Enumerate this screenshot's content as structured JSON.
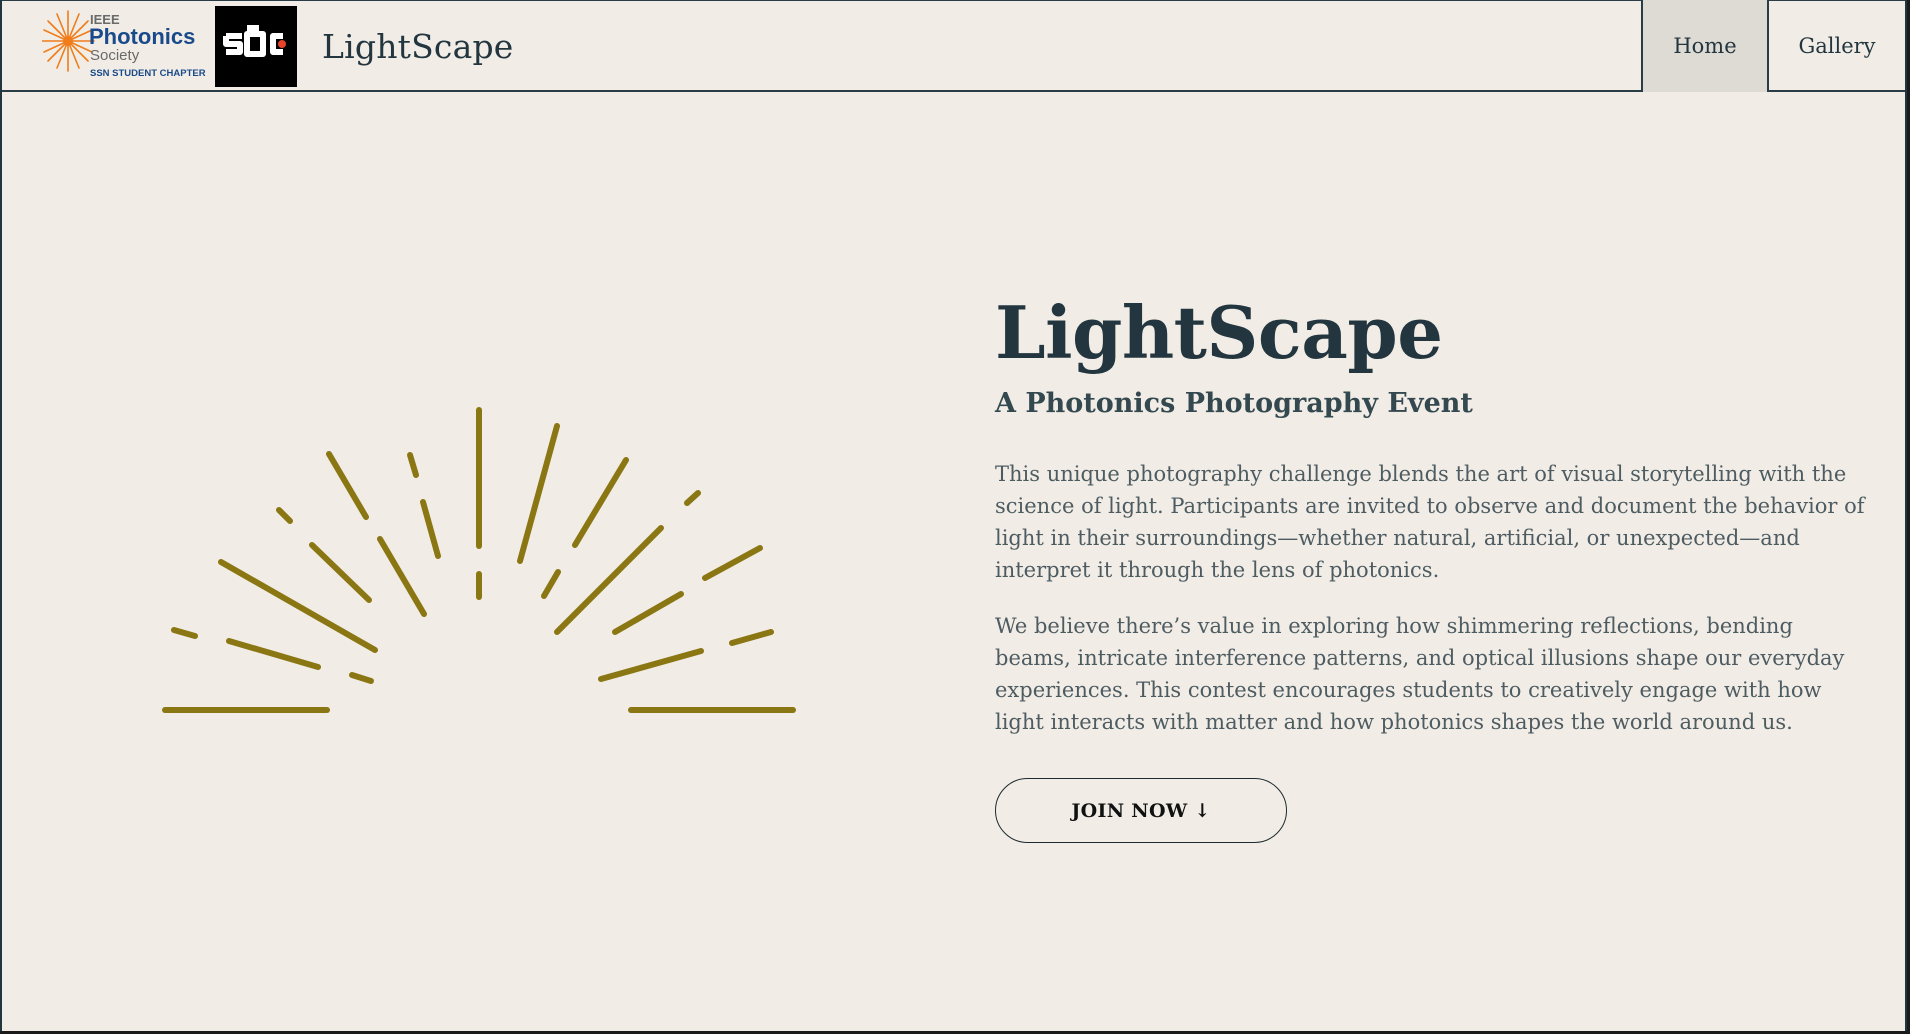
{
  "header": {
    "logos": {
      "ieee": {
        "line1": "IEEE",
        "line2": "Photonics",
        "line3": "Society",
        "line4": "SSN STUDENT CHAPTER",
        "icon": "sunburst-logo-icon",
        "accent_color": "#f07d1a",
        "text_color": "#1a4a8a"
      },
      "sdc": {
        "text": "SDC",
        "icon": "sdc-logo-icon",
        "background": "#000000",
        "dot_color": "#e8432b"
      }
    },
    "brand_title": "LightScape",
    "nav": {
      "home_label": "Home",
      "gallery_label": "Gallery",
      "active": "Home"
    }
  },
  "hero": {
    "illustration": "light-rays-icon",
    "ray_color": "#8a7612",
    "title": "LightScape",
    "subtitle": "A Photonics Photography Event",
    "paragraph1": "This unique photography challenge blends the art of visual storytelling with the science of light. Participants are invited to observe and document the behavior of light in their surroundings—whether natural, artificial, or unexpected—and interpret it through the lens of photonics.",
    "paragraph2": "We believe there’s value in exploring how shimmering reflections, bending beams, intricate interference patterns, and optical illusions shape our everyday experiences. This contest encourages students to creatively engage with how light interacts with matter and how photonics shapes the world around us.",
    "cta_label": "JOIN NOW ↓"
  },
  "colors": {
    "background": "#f1ede6",
    "text_dark": "#233640",
    "nav_active_bg": "#dedbd5"
  }
}
